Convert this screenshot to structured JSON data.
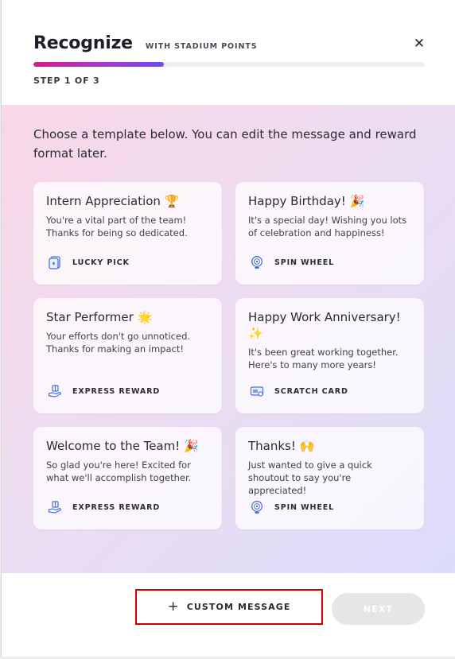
{
  "header": {
    "title": "Recognize",
    "subtitle": "WITH STADIUM POINTS",
    "close_glyph": "✕",
    "step_label": "STEP 1 OF 3",
    "progress_fraction": 0.333
  },
  "intro": "Choose a template below. You can edit the message and reward format later.",
  "templates": [
    {
      "title": "Intern Appreciation 🏆",
      "description": "You're a vital part of the team! Thanks for being so dedicated.",
      "reward": "LUCKY PICK",
      "reward_icon": "lucky-pick-icon"
    },
    {
      "title": "Happy Birthday! 🎉",
      "description": "It's a special day! Wishing you lots of celebration and happiness!",
      "reward": "SPIN WHEEL",
      "reward_icon": "spin-wheel-icon"
    },
    {
      "title": "Star Performer 🌟",
      "description": "Your efforts don't go unnoticed. Thanks for making an impact!",
      "reward": "EXPRESS REWARD",
      "reward_icon": "express-reward-icon"
    },
    {
      "title": "Happy Work Anniversary! ✨",
      "description": "It's been great working together. Here's to many more years!",
      "reward": "SCRATCH CARD",
      "reward_icon": "scratch-card-icon"
    },
    {
      "title": "Welcome to the Team! 🎉",
      "description": "So glad you're here! Excited for what we'll accomplish together.",
      "reward": "EXPRESS REWARD",
      "reward_icon": "express-reward-icon"
    },
    {
      "title": "Thanks! 🙌",
      "description": "Just wanted to give a quick shoutout to say you're appreciated!",
      "reward": "SPIN WHEEL",
      "reward_icon": "spin-wheel-icon"
    }
  ],
  "footer": {
    "custom_plus": "+",
    "custom_label": "CUSTOM MESSAGE",
    "next_label": "NEXT"
  },
  "colors": {
    "highlight_border": "#d10000",
    "progress_start": "#d81b8c",
    "progress_end": "#6b4af0",
    "icon_blue": "#4a6fd8"
  }
}
